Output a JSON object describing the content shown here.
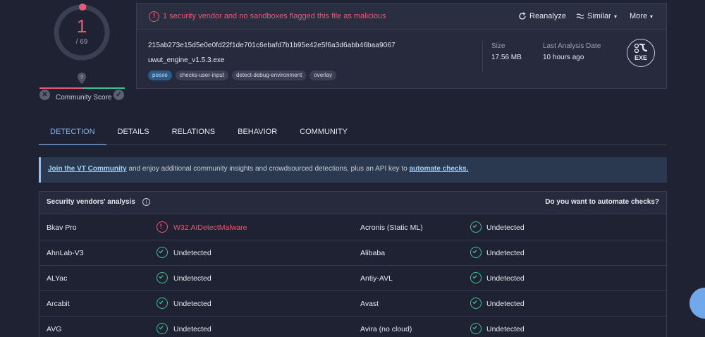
{
  "score": {
    "detections": "1",
    "total": "/ 69",
    "community_label": "Community Score"
  },
  "header": {
    "alert": "1 security vendor and no sandboxes flagged this file as malicious",
    "reanalyze": "Reanalyze",
    "similar": "Similar",
    "more": "More",
    "hash": "215ab273e15d5e0e0fd22f1de701c6ebafd7b1b95e42e5f6a3d6abb46baa9067",
    "filename": "uwut_engine_v1.5.3.exe",
    "tags": [
      "peexe",
      "checks-user-input",
      "detect-debug-environment",
      "overlay"
    ],
    "size_label": "Size",
    "size_value": "17.56 MB",
    "date_label": "Last Analysis Date",
    "date_value": "10 hours ago",
    "type_badge": "EXE"
  },
  "tabs": [
    "DETECTION",
    "DETAILS",
    "RELATIONS",
    "BEHAVIOR",
    "COMMUNITY"
  ],
  "banner": {
    "link1": "Join the VT Community",
    "text": " and enjoy additional community insights and crowdsourced detections, plus an API key to ",
    "link2": "automate checks."
  },
  "vendors": {
    "title": "Security vendors' analysis",
    "automate": "Do you want to automate checks?",
    "rows": [
      {
        "left": {
          "name": "Bkav Pro",
          "result": "W32.AIDetectMalware",
          "status": "malicious"
        },
        "right": {
          "name": "Acronis (Static ML)",
          "result": "Undetected",
          "status": "clean"
        }
      },
      {
        "left": {
          "name": "AhnLab-V3",
          "result": "Undetected",
          "status": "clean"
        },
        "right": {
          "name": "Alibaba",
          "result": "Undetected",
          "status": "clean"
        }
      },
      {
        "left": {
          "name": "ALYac",
          "result": "Undetected",
          "status": "clean"
        },
        "right": {
          "name": "Antiy-AVL",
          "result": "Undetected",
          "status": "clean"
        }
      },
      {
        "left": {
          "name": "Arcabit",
          "result": "Undetected",
          "status": "clean"
        },
        "right": {
          "name": "Avast",
          "result": "Undetected",
          "status": "clean"
        }
      },
      {
        "left": {
          "name": "AVG",
          "result": "Undetected",
          "status": "clean"
        },
        "right": {
          "name": "Avira (no cloud)",
          "result": "Undetected",
          "status": "clean"
        }
      }
    ]
  },
  "colors": {
    "malicious": "#e85a72",
    "clean": "#3ec28f",
    "accent": "#7fb4ea"
  }
}
